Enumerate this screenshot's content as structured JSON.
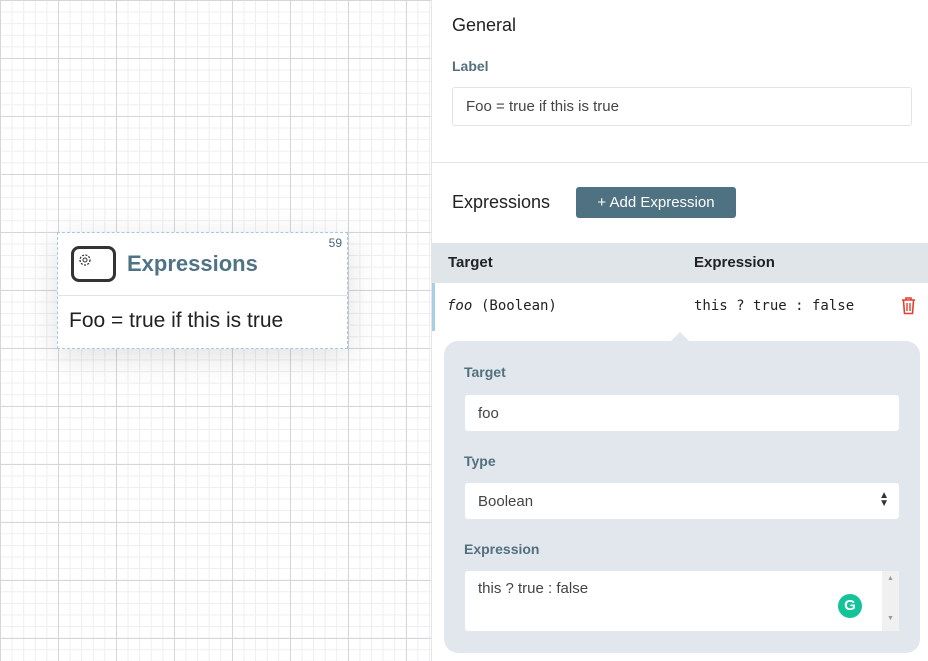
{
  "canvas": {
    "node": {
      "id": "59",
      "title": "Expressions",
      "label": "Foo = true if this is true",
      "icon": "gear-task-icon"
    }
  },
  "panel": {
    "general": {
      "heading": "General",
      "label_field": "Label",
      "label_value": "Foo = true if this is true"
    },
    "expressions": {
      "heading": "Expressions",
      "add_button": "+ Add Expression",
      "columns": [
        "Target",
        "Expression"
      ],
      "rows": [
        {
          "target": "foo",
          "type": "(Boolean)",
          "expression": "this ? true : false",
          "delete_icon": "trash-icon"
        }
      ],
      "editor": {
        "target_label": "Target",
        "target_value": "foo",
        "type_label": "Type",
        "type_value": "Boolean",
        "expression_label": "Expression",
        "expression_value": "this ? true : false"
      }
    }
  },
  "colors": {
    "accent": "#4f7282",
    "delete": "#e0412f",
    "grammarly": "#15c39a"
  }
}
